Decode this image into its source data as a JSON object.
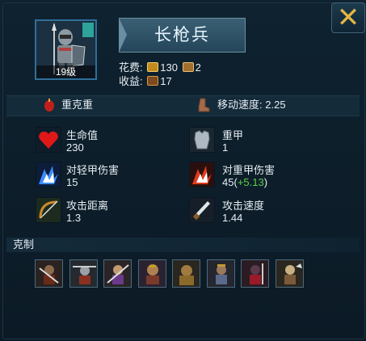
{
  "unit": {
    "name": "长枪兵",
    "level_label": "19级",
    "cost_label": "花费:",
    "cost_gold": "130",
    "cost_supply": "2",
    "income_label": "收益:",
    "income_value": "17"
  },
  "info_band": {
    "trait": "重克重",
    "move_speed_label": "移动速度:",
    "move_speed_value": "2.25"
  },
  "attributes": [
    {
      "name": "生命值",
      "value": "230",
      "icon": "heart-icon"
    },
    {
      "name": "重甲",
      "value": "1",
      "icon": "heavy-armor-icon"
    },
    {
      "name": "对轻甲伤害",
      "value": "15",
      "icon": "light-armor-damage-icon"
    },
    {
      "name": "对重甲伤害",
      "value": "45",
      "bonus": "+5.13",
      "icon": "heavy-armor-damage-icon"
    },
    {
      "name": "攻击距离",
      "value": "1.3",
      "icon": "bow-icon"
    },
    {
      "name": "攻击速度",
      "value": "1.44",
      "icon": "dagger-icon"
    }
  ],
  "counter": {
    "label": "克制",
    "units": [
      "counter-unit-1",
      "counter-unit-2",
      "counter-unit-3",
      "counter-unit-4",
      "counter-unit-5",
      "counter-unit-6",
      "counter-unit-7",
      "counter-unit-8"
    ]
  },
  "colors": {
    "accent_gold": "#e3b743",
    "bonus_green": "#5fcf4a",
    "panel_bg": "#0f2230"
  }
}
